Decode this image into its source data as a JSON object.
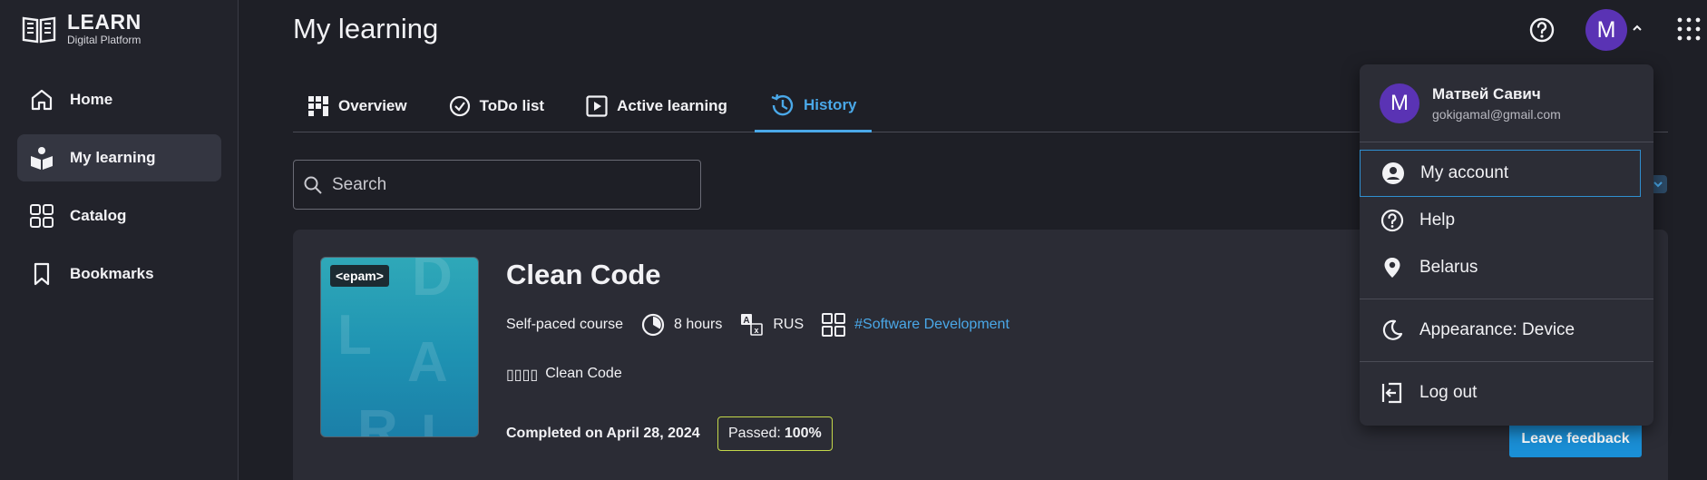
{
  "brand": {
    "title": "LEARN",
    "subtitle": "Digital Platform"
  },
  "sidebar": {
    "items": [
      {
        "label": "Home",
        "icon": "home-icon",
        "active": false
      },
      {
        "label": "My learning",
        "icon": "learning-icon",
        "active": true
      },
      {
        "label": "Catalog",
        "icon": "grid-icon",
        "active": false
      },
      {
        "label": "Bookmarks",
        "icon": "bookmark-icon",
        "active": false
      }
    ]
  },
  "header": {
    "title": "My learning",
    "avatar_initial": "M"
  },
  "tabs": [
    {
      "label": "Overview",
      "icon": "grid-icon",
      "active": false
    },
    {
      "label": "ToDo list",
      "icon": "check-circle-icon",
      "active": false
    },
    {
      "label": "Active learning",
      "icon": "play-icon",
      "active": false
    },
    {
      "label": "History",
      "icon": "history-icon",
      "active": true
    }
  ],
  "search": {
    "placeholder": "Search"
  },
  "course": {
    "logo_text": "<epam>",
    "title": "Clean Code",
    "type": "Self-paced course",
    "duration": "8 hours",
    "language": "RUS",
    "tag": "#Software Development",
    "subtitle_glyphs": "▯▯▯▯",
    "subtitle": "Clean Code",
    "completed": "Completed on April 28, 2024",
    "passed_label": "Passed:",
    "passed_value": "100%",
    "feedback_button": "Leave feedback"
  },
  "user_menu": {
    "initial": "M",
    "name": "Матвей Савич",
    "email": "gokigamal@gmail.com",
    "items": [
      {
        "label": "My account",
        "icon": "account-icon"
      },
      {
        "label": "Help",
        "icon": "help-icon"
      },
      {
        "label": "Belarus",
        "icon": "location-icon"
      },
      {
        "label": "Appearance: Device",
        "icon": "moon-icon"
      },
      {
        "label": "Log out",
        "icon": "logout-icon"
      }
    ]
  },
  "colors": {
    "accent": "#4aa8e8",
    "button": "#1a8fd6",
    "avatar": "#5a33b4",
    "passed_border": "#c4d84a"
  }
}
